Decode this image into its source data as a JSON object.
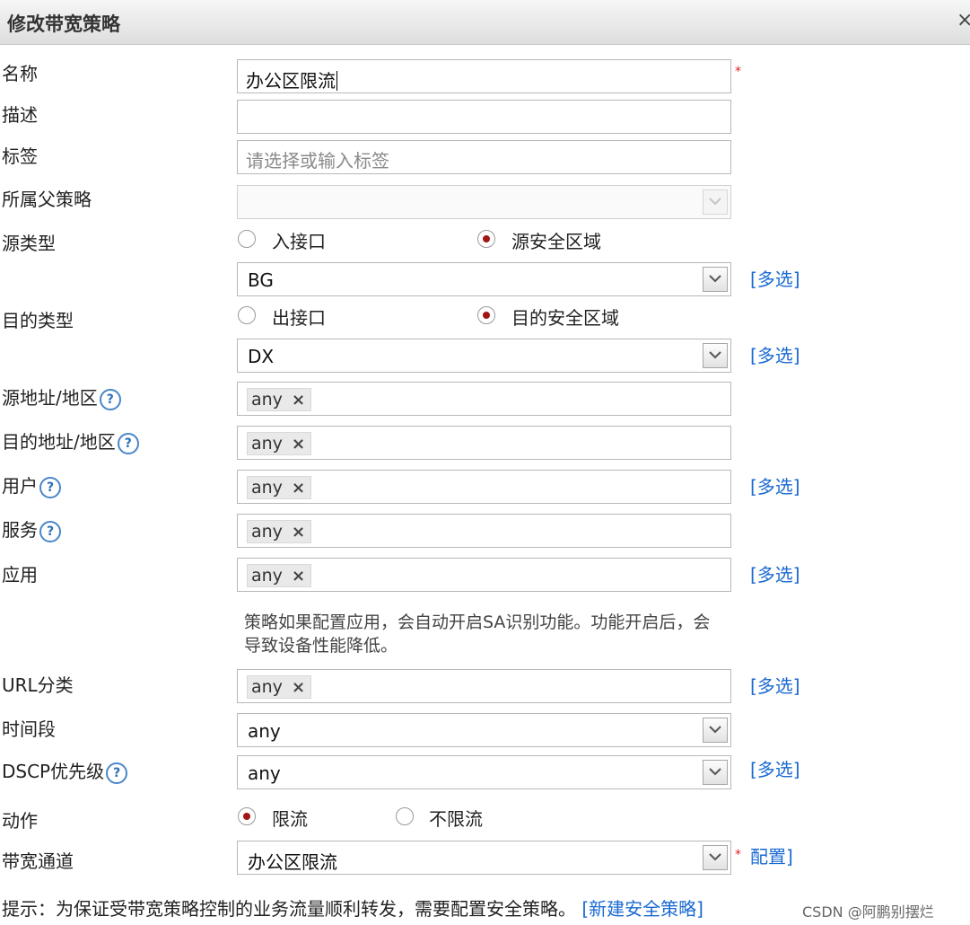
{
  "dialog": {
    "title": "修改带宽策略",
    "close_label": "×"
  },
  "fields": {
    "name": {
      "label": "名称",
      "value": "办公区限流",
      "required_mark": "*"
    },
    "description": {
      "label": "描述",
      "value": ""
    },
    "tags": {
      "label": "标签",
      "placeholder": "请选择或输入标签"
    },
    "parent_policy": {
      "label": "所属父策略",
      "value": ""
    },
    "source_type": {
      "label": "源类型",
      "options": [
        "入接口",
        "源安全区域"
      ],
      "selected": "源安全区域",
      "select_value": "BG",
      "multi_label": "[多选]"
    },
    "dest_type": {
      "label": "目的类型",
      "options": [
        "出接口",
        "目的安全区域"
      ],
      "selected": "目的安全区域",
      "select_value": "DX",
      "multi_label": "[多选]"
    },
    "source_address": {
      "label": "源地址/地区",
      "help": "?",
      "tags": [
        "any"
      ]
    },
    "dest_address": {
      "label": "目的地址/地区",
      "help": "?",
      "tags": [
        "any"
      ]
    },
    "user": {
      "label": "用户",
      "help": "?",
      "tags": [
        "any"
      ],
      "multi_label": "[多选]"
    },
    "service": {
      "label": "服务",
      "help": "?",
      "tags": [
        "any"
      ]
    },
    "application": {
      "label": "应用",
      "tags": [
        "any"
      ],
      "multi_label": "[多选]",
      "note": "策略如果配置应用，会自动开启SA识别功能。功能开启后，会导致设备性能降低。"
    },
    "url_category": {
      "label": "URL分类",
      "tags": [
        "any"
      ],
      "multi_label": "[多选]"
    },
    "time_range": {
      "label": "时间段",
      "value": "any"
    },
    "dscp": {
      "label": "DSCP优先级",
      "help": "?",
      "value": "any",
      "multi_label": "[多选]"
    },
    "action": {
      "label": "动作",
      "options": [
        "限流",
        "不限流"
      ],
      "selected": "限流"
    },
    "bandwidth_channel": {
      "label": "带宽通道",
      "value": "办公区限流",
      "required_mark": "*",
      "config_label": "配置]"
    }
  },
  "tag_remove_symbol": "×",
  "footer": {
    "tip": "提示：为保证受带宽策略控制的业务流量顺利转发，需要配置安全策略。",
    "link": "[新建安全策略]"
  },
  "watermark": "CSDN @阿鹏别摆烂",
  "colors": {
    "link": "#1a6ad1",
    "required": "#e02020",
    "radio_dot": "#a11515"
  },
  "icons": {
    "dropdown": "chevron-down-icon",
    "help": "question-circle-icon",
    "close": "close-icon"
  }
}
